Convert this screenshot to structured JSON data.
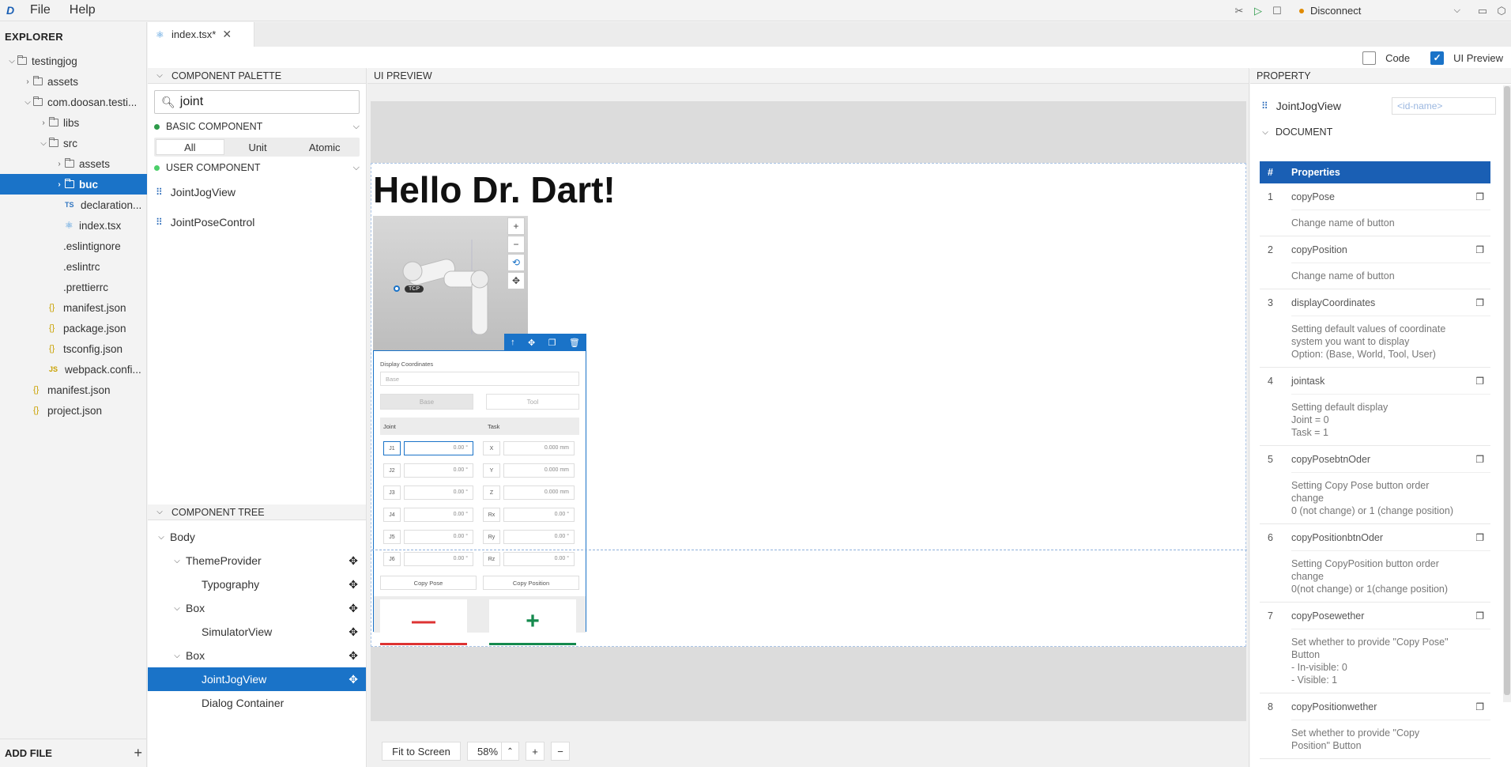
{
  "menu": {
    "logo": "D",
    "items": [
      "File",
      "Help"
    ]
  },
  "toolbar": {
    "connection": "Disconnect",
    "conn_color": "#e08a00"
  },
  "explorer": {
    "title": "EXPLORER",
    "items": [
      {
        "label": "testingjog",
        "type": "folder",
        "indent": 0,
        "open": true
      },
      {
        "label": "assets",
        "type": "folder",
        "indent": 1,
        "open": false
      },
      {
        "label": "com.doosan.testi...",
        "type": "folder",
        "indent": 1,
        "open": true
      },
      {
        "label": "libs",
        "type": "folder",
        "indent": 2,
        "open": false
      },
      {
        "label": "src",
        "type": "folder",
        "indent": 2,
        "open": true
      },
      {
        "label": "assets",
        "type": "folder",
        "indent": 3,
        "open": false
      },
      {
        "label": "buc",
        "type": "folder",
        "indent": 3,
        "open": false,
        "selected": true
      },
      {
        "label": "declaration...",
        "type": "ts",
        "indent": 3
      },
      {
        "label": "index.tsx",
        "type": "react",
        "indent": 3
      },
      {
        "label": ".eslintignore",
        "type": "file",
        "indent": 2
      },
      {
        "label": ".eslintrc",
        "type": "file",
        "indent": 2
      },
      {
        "label": ".prettierrc",
        "type": "file",
        "indent": 2
      },
      {
        "label": "manifest.json",
        "type": "json",
        "indent": 2
      },
      {
        "label": "package.json",
        "type": "json",
        "indent": 2
      },
      {
        "label": "tsconfig.json",
        "type": "json",
        "indent": 2
      },
      {
        "label": "webpack.confi...",
        "type": "js",
        "indent": 2
      },
      {
        "label": "manifest.json",
        "type": "json",
        "indent": 1
      },
      {
        "label": "project.json",
        "type": "json",
        "indent": 1
      }
    ],
    "add_file": "ADD FILE"
  },
  "tab": {
    "label": "index.tsx*"
  },
  "view_toggles": {
    "code": "Code",
    "ui_preview": "UI Preview"
  },
  "palette": {
    "title": "COMPONENT PALETTE",
    "search_value": "joint",
    "basic": "BASIC COMPONENT",
    "segments": [
      "All",
      "Unit",
      "Atomic"
    ],
    "user": "USER COMPONENT",
    "components": [
      "JointJogView",
      "JointPoseControl"
    ]
  },
  "tree": {
    "title": "COMPONENT TREE",
    "items": [
      {
        "label": "Body",
        "indent": 0,
        "caret": true,
        "move": false
      },
      {
        "label": "ThemeProvider",
        "indent": 1,
        "caret": true,
        "move": true
      },
      {
        "label": "Typography",
        "indent": 2,
        "caret": false,
        "move": true
      },
      {
        "label": "Box",
        "indent": 1,
        "caret": true,
        "move": true
      },
      {
        "label": "SimulatorView",
        "indent": 2,
        "caret": false,
        "move": true
      },
      {
        "label": "Box",
        "indent": 1,
        "caret": true,
        "move": true
      },
      {
        "label": "JointJogView",
        "indent": 2,
        "caret": false,
        "move": true,
        "selected": true
      },
      {
        "label": "Dialog Container",
        "indent": 2,
        "caret": false,
        "move": false
      }
    ]
  },
  "preview": {
    "title": "UI PREVIEW",
    "heading": "Hello Dr. Dart!",
    "tcp": "TCP",
    "jog": {
      "display_label": "Display Coordinates",
      "dropdown": "Base",
      "seg_base": "Base",
      "seg_tool": "Tool",
      "col_joint": "Joint",
      "col_task": "Task",
      "rows": [
        {
          "j": "J1",
          "jv": "0.00 °",
          "t": "X",
          "tv": "0.000 mm"
        },
        {
          "j": "J2",
          "jv": "0.00 °",
          "t": "Y",
          "tv": "0.000 mm"
        },
        {
          "j": "J3",
          "jv": "0.00 °",
          "t": "Z",
          "tv": "0.000 mm"
        },
        {
          "j": "J4",
          "jv": "0.00 °",
          "t": "Rx",
          "tv": "0.00 °"
        },
        {
          "j": "J5",
          "jv": "0.00 °",
          "t": "Ry",
          "tv": "0.00 °"
        },
        {
          "j": "J6",
          "jv": "0.00 °",
          "t": "Rz",
          "tv": "0.00 °"
        }
      ],
      "copy_pose": "Copy Pose",
      "copy_position": "Copy Position",
      "minus": "—",
      "plus": "+"
    },
    "fit_to_screen": "Fit to Screen",
    "zoom": "58%"
  },
  "property": {
    "title": "PROPERTY",
    "component": "JointJogView",
    "id_placeholder": "<id-name>",
    "document": "DOCUMENT",
    "col_num": "#",
    "col_props": "Properties",
    "rows": [
      {
        "n": "1",
        "name": "copyPose",
        "desc": "Change name of button"
      },
      {
        "n": "2",
        "name": "copyPosition",
        "desc": "Change name of button"
      },
      {
        "n": "3",
        "name": "displayCoordinates",
        "desc": "Setting default values of coordinate\nsystem you want to display\nOption: (Base, World, Tool, User)"
      },
      {
        "n": "4",
        "name": "jointask",
        "desc": "Setting default display\nJoint = 0\nTask = 1"
      },
      {
        "n": "5",
        "name": "copyPosebtnOder",
        "desc": "Setting Copy Pose button order\nchange\n0 (not change) or 1 (change position)"
      },
      {
        "n": "6",
        "name": "copyPositionbtnOder",
        "desc": "Setting CopyPosition button order\nchange\n0(not change) or 1(change position)"
      },
      {
        "n": "7",
        "name": "copyPosewether",
        "desc": "Set whether to provide \"Copy Pose\"\nButton\n- In-visible: 0\n- Visible: 1"
      },
      {
        "n": "8",
        "name": "copyPositionwether",
        "desc": "Set whether to provide \"Copy\nPosition\" Button"
      }
    ]
  }
}
